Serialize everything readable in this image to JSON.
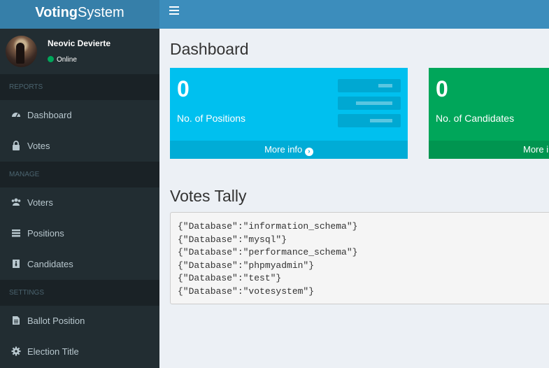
{
  "header": {
    "logo_bold": "Voting",
    "logo_rest": "System"
  },
  "user": {
    "name": "Neovic Devierte",
    "status": "Online"
  },
  "sidebar": {
    "sections": [
      {
        "header": "REPORTS",
        "items": [
          {
            "label": "Dashboard",
            "icon": "dashboard-icon"
          },
          {
            "label": "Votes",
            "icon": "lock-icon"
          }
        ]
      },
      {
        "header": "MANAGE",
        "items": [
          {
            "label": "Voters",
            "icon": "users-icon"
          },
          {
            "label": "Positions",
            "icon": "tasks-icon"
          },
          {
            "label": "Candidates",
            "icon": "black-tie-icon"
          }
        ]
      },
      {
        "header": "SETTINGS",
        "items": [
          {
            "label": "Ballot Position",
            "icon": "file-text-icon"
          },
          {
            "label": "Election Title",
            "icon": "cog-icon"
          }
        ]
      }
    ]
  },
  "main": {
    "title": "Dashboard",
    "boxes": [
      {
        "value": "0",
        "label": "No. of Positions",
        "footer": "More info",
        "color": "#00c0ef"
      },
      {
        "value": "0",
        "label": "No. of Candidates",
        "footer": "More info",
        "color": "#00a65a"
      }
    ],
    "tally_title": "Votes Tally",
    "tally_lines": [
      "{\"Database\":\"information_schema\"}",
      "{\"Database\":\"mysql\"}",
      "{\"Database\":\"performance_schema\"}",
      "{\"Database\":\"phpmyadmin\"}",
      "{\"Database\":\"test\"}",
      "{\"Database\":\"votesystem\"}"
    ]
  }
}
